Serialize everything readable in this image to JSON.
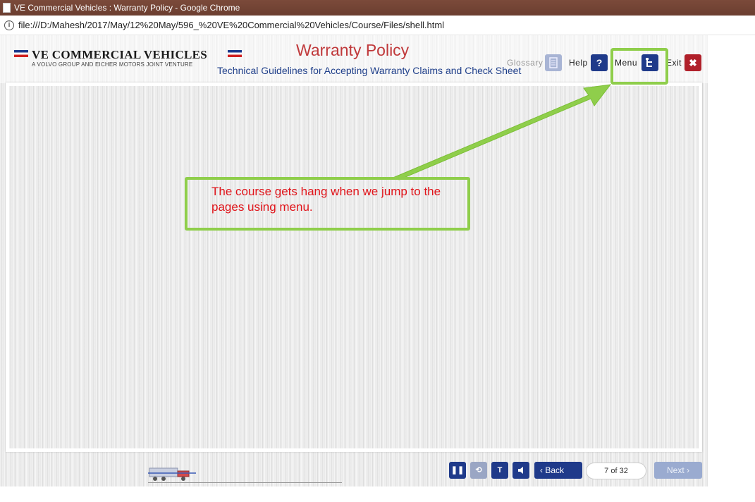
{
  "window": {
    "title": "VE Commercial Vehicles : Warranty Policy - Google Chrome",
    "url": "file:///D:/Mahesh/2017/May/12%20May/596_%20VE%20Commercial%20Vehicles/Course/Files/shell.html"
  },
  "brand": {
    "name": "VE COMMERCIAL VEHICLES",
    "tagline": "A VOLVO GROUP AND EICHER MOTORS JOINT VENTURE"
  },
  "course": {
    "title": "Warranty Policy",
    "subtitle": "Technical Guidelines for Accepting Warranty Claims and Check Sheet"
  },
  "header_nav": {
    "glossary_label": "Glossary",
    "help_label": "Help",
    "menu_label": "Menu",
    "exit_label": "Exit",
    "help_icon_glyph": "?"
  },
  "annotation": {
    "text": "The course gets hang when we jump to the pages using menu.",
    "color": "#e0141a",
    "highlight_color": "#8fce4b"
  },
  "footer": {
    "back_label": "Back",
    "next_label": "Next",
    "page_counter": "7 of 32",
    "transcript_glyph": "T"
  },
  "colors": {
    "accent": "#1f3a8a",
    "title_red": "#c0393b",
    "exit_red": "#b0202a"
  }
}
